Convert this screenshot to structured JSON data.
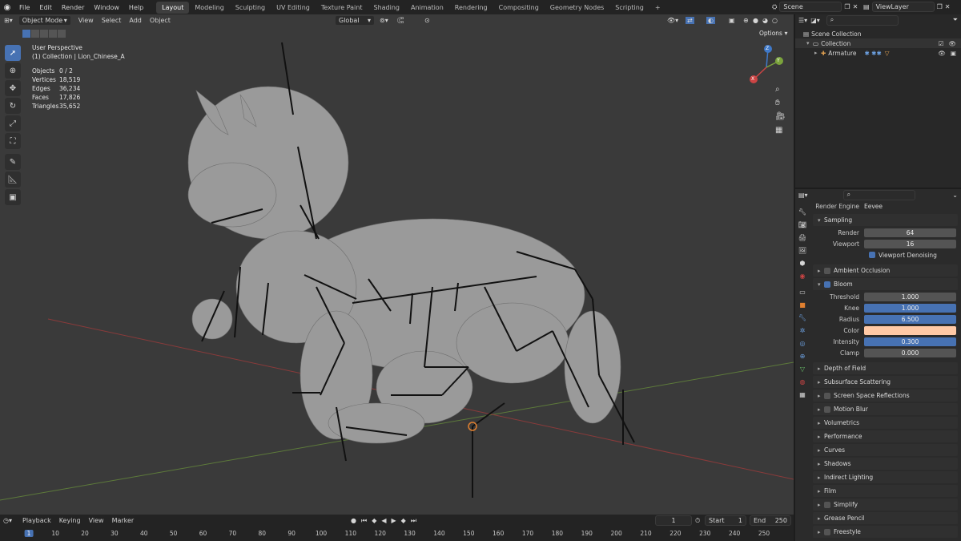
{
  "top_menu": [
    "File",
    "Edit",
    "Render",
    "Window",
    "Help"
  ],
  "workspace_tabs": [
    "Layout",
    "Modeling",
    "Sculpting",
    "UV Editing",
    "Texture Paint",
    "Shading",
    "Animation",
    "Rendering",
    "Compositing",
    "Geometry Nodes",
    "Scripting"
  ],
  "active_tab": "Layout",
  "add_tab": "+",
  "scene": "Scene",
  "view_layer": "ViewLayer",
  "viewport_header": {
    "mode": "Object Mode",
    "menus": [
      "View",
      "Select",
      "Add",
      "Object"
    ],
    "transform_orientation": "Global",
    "options": "Options"
  },
  "viewport_info": {
    "perspective": "User Perspective",
    "collection": "(1) Collection | Lion_Chinese_A",
    "stats": [
      {
        "label": "Objects",
        "value": "0 / 2"
      },
      {
        "label": "Vertices",
        "value": "18,519"
      },
      {
        "label": "Edges",
        "value": "36,234"
      },
      {
        "label": "Faces",
        "value": "17,826"
      },
      {
        "label": "Triangles",
        "value": "35,652"
      }
    ]
  },
  "gizmo": {
    "x": "X",
    "y": "Y",
    "z": "Z"
  },
  "outliner": {
    "root": "Scene Collection",
    "collection": "Collection",
    "armature": "Armature"
  },
  "properties": {
    "render_engine_label": "Render Engine",
    "render_engine_value": "Eevee",
    "sampling": {
      "title": "Sampling",
      "render_label": "Render",
      "render_value": "64",
      "viewport_label": "Viewport",
      "viewport_value": "16",
      "denoise": "Viewport Denoising"
    },
    "ambient_occlusion": "Ambient Occlusion",
    "bloom": {
      "title": "Bloom",
      "threshold_label": "Threshold",
      "threshold": "1.000",
      "knee_label": "Knee",
      "knee": "1.000",
      "radius_label": "Radius",
      "radius": "6.500",
      "color_label": "Color",
      "color": "#ffc9a6",
      "intensity_label": "Intensity",
      "intensity": "0.300",
      "clamp_label": "Clamp",
      "clamp": "0.000"
    },
    "sections": [
      "Depth of Field",
      "Subsurface Scattering",
      "Screen Space Reflections",
      "Motion Blur",
      "Volumetrics",
      "Performance",
      "Curves",
      "Shadows",
      "Indirect Lighting",
      "Film",
      "Simplify",
      "Grease Pencil",
      "Freestyle"
    ],
    "checkbox_sections": [
      "Screen Space Reflections",
      "Motion Blur",
      "Simplify",
      "Freestyle"
    ]
  },
  "timeline": {
    "menus": [
      "Playback",
      "Keying",
      "View",
      "Marker"
    ],
    "current_frame": "1",
    "start_label": "Start",
    "start": "1",
    "end_label": "End",
    "end": "250",
    "ticks": [
      "1",
      "10",
      "20",
      "30",
      "40",
      "50",
      "60",
      "70",
      "80",
      "90",
      "100",
      "110",
      "120",
      "130",
      "140",
      "150",
      "160",
      "170",
      "180",
      "190",
      "200",
      "210",
      "220",
      "230",
      "240",
      "250"
    ]
  },
  "colors": {
    "accent": "#4772b3",
    "bg_viewport": "#3a3a3a",
    "panel": "#2b2b2b"
  }
}
